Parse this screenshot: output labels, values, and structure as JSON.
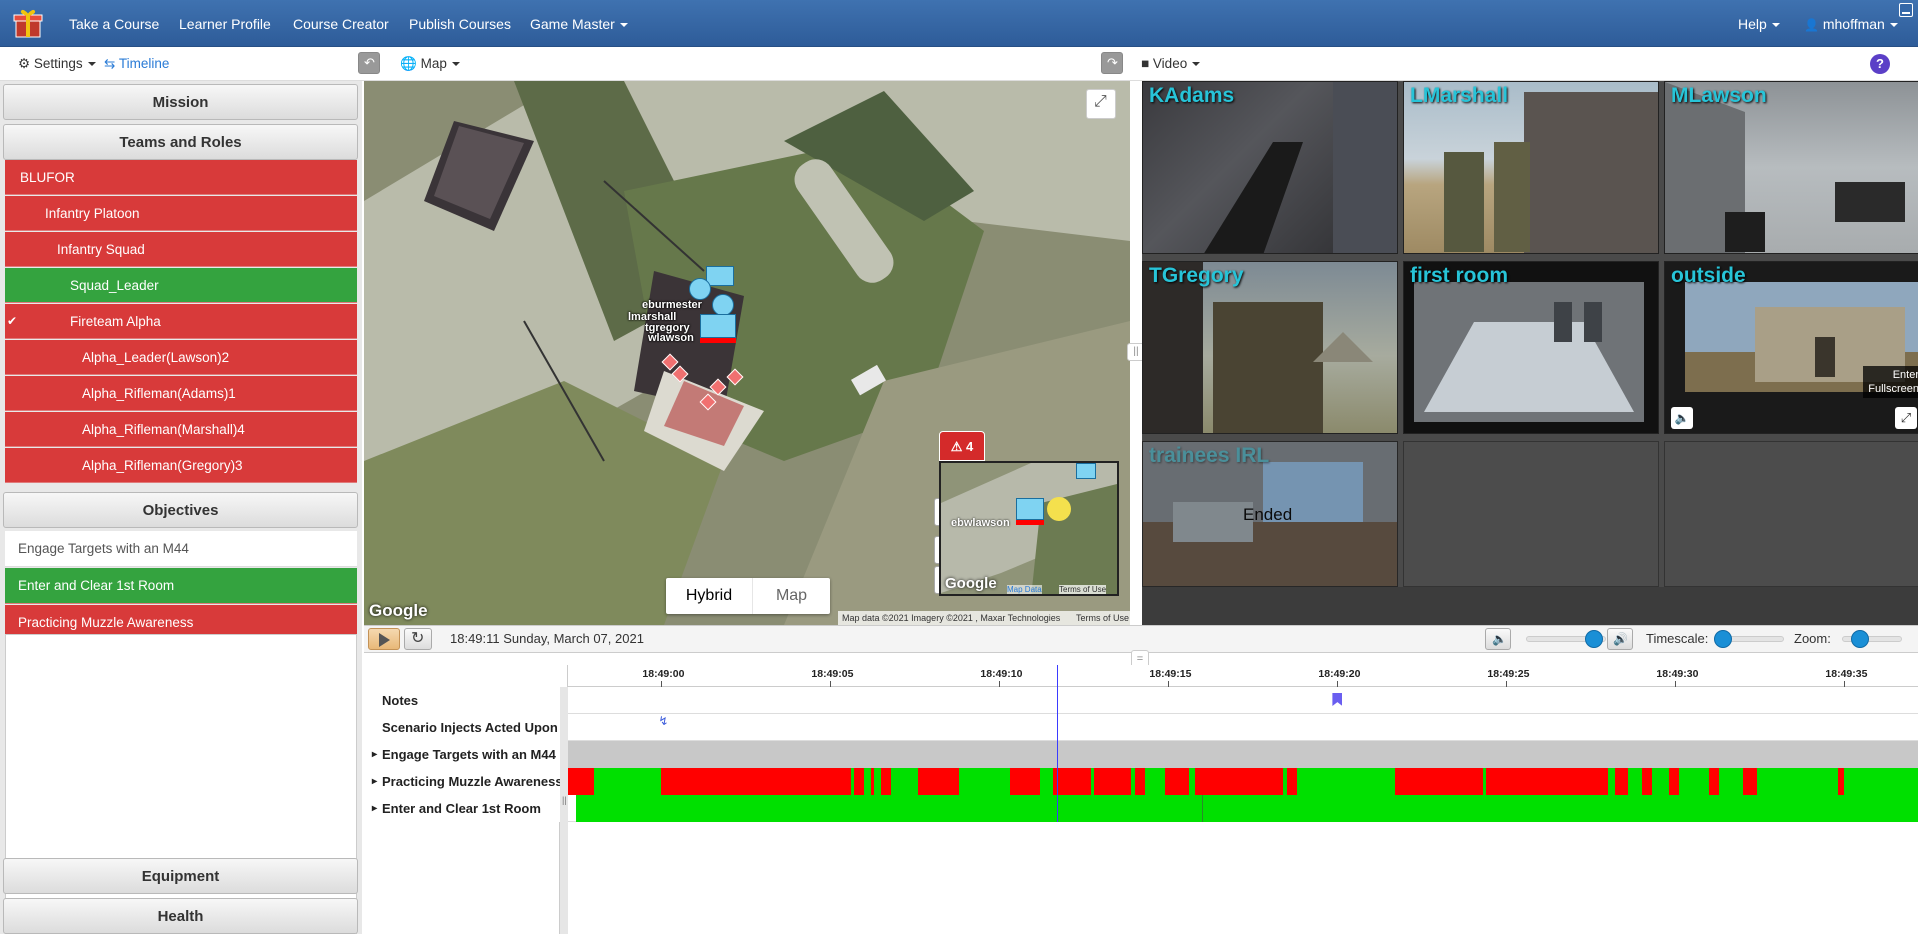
{
  "navbar": {
    "logo_icon": "gift-icon",
    "items": [
      "Take a Course",
      "Learner Profile",
      "Course Creator",
      "Publish Courses",
      "Game Master"
    ],
    "help": "Help",
    "user": "mhoffman",
    "bg": "#3568a8"
  },
  "toolbar": {
    "settings": "Settings",
    "timeline": "Timeline",
    "map": "Map",
    "video": "Video"
  },
  "sidebar": {
    "mission": "Mission",
    "teams_title": "Teams and Roles",
    "roles": [
      {
        "label": "BLUFOR",
        "status": "red",
        "indent": 0,
        "checked": false
      },
      {
        "label": "Infantry Platoon",
        "status": "red",
        "indent": 1,
        "checked": false
      },
      {
        "label": "Infantry Squad",
        "status": "red",
        "indent": 2,
        "checked": false
      },
      {
        "label": "Squad_Leader",
        "status": "green",
        "indent": 3,
        "checked": false
      },
      {
        "label": "Fireteam Alpha",
        "status": "red",
        "indent": 3,
        "checked": true
      },
      {
        "label": "Alpha_Leader(Lawson)2",
        "status": "red",
        "indent": 4,
        "checked": false
      },
      {
        "label": "Alpha_Rifleman(Adams)1",
        "status": "red",
        "indent": 4,
        "checked": false
      },
      {
        "label": "Alpha_Rifleman(Marshall)4",
        "status": "red",
        "indent": 4,
        "checked": false
      },
      {
        "label": "Alpha_Rifleman(Gregory)3",
        "status": "red",
        "indent": 4,
        "checked": false
      }
    ],
    "objectives_title": "Objectives",
    "objectives": [
      {
        "label": "Engage Targets with an M44",
        "status": "white"
      },
      {
        "label": "Enter and Clear 1st Room",
        "status": "green"
      },
      {
        "label": "Practicing Muzzle Awareness",
        "status": "red"
      }
    ],
    "equipment": "Equipment",
    "health": "Health"
  },
  "map": {
    "unit_labels": [
      "eburmester",
      "lmarshall",
      "tgregory",
      "wlawson"
    ],
    "google": "Google",
    "type_buttons": [
      "Hybrid",
      "Map"
    ],
    "attribution": "Map data ©2021 Imagery ©2021 , Maxar Technologies",
    "terms": "Terms of Use",
    "alert_count": "4",
    "minimap_label": "wlawson",
    "minimap_label_prefix": "eb",
    "minimap_google": "Google",
    "minimap_mapdata": "Map Data",
    "minimap_terms": "Terms of Use"
  },
  "video": {
    "cells": [
      {
        "label": "KAdams"
      },
      {
        "label": "LMarshall"
      },
      {
        "label": "MLawson"
      },
      {
        "label": "TGregory"
      },
      {
        "label": "first room"
      },
      {
        "label": "outside"
      },
      {
        "label": "trainees IRL"
      }
    ],
    "fullscreen_tooltip": "Enter Fullscreen",
    "ended": "Ended"
  },
  "playback": {
    "timestamp": "18:49:11 Sunday, March 07, 2021",
    "timescale": "Timescale:",
    "zoom": "Zoom:",
    "volume_level": 0.85,
    "timescale_level": 0.05,
    "zoom_level": 0.3
  },
  "timeline": {
    "ticks": [
      "18:49:00",
      "18:49:05",
      "18:49:10",
      "18:49:15",
      "18:49:20",
      "18:49:25",
      "18:49:30",
      "18:49:35"
    ],
    "rows": [
      {
        "label": "Notes",
        "expandable": false
      },
      {
        "label": "Scenario Injects Acted Upon",
        "expandable": false
      },
      {
        "label": "Engage Targets with an M44",
        "expandable": true
      },
      {
        "label": "Practicing Muzzle Awareness",
        "expandable": true
      },
      {
        "label": "Enter and Clear 1st Room",
        "expandable": true
      }
    ],
    "playhead_time": "18:49:11.7",
    "note_marker_time": "18:49:20",
    "inject_marker_time": "18:49:00",
    "muzzle_red_segments": [
      [
        "18:48:57",
        "18:48:58"
      ],
      [
        "18:49:00",
        "18:49:05.6"
      ],
      [
        "18:49:05.7",
        "18:49:06"
      ],
      [
        "18:49:06.2",
        "18:49:06.3"
      ],
      [
        "18:49:06.5",
        "18:49:06.8"
      ],
      [
        "18:49:07.6",
        "18:49:08.8"
      ],
      [
        "18:49:10.3",
        "18:49:11.2"
      ],
      [
        "18:49:11.6",
        "18:49:12.7"
      ],
      [
        "18:49:12.8",
        "18:49:13.9"
      ],
      [
        "18:49:14.0",
        "18:49:14.3"
      ],
      [
        "18:49:14.9",
        "18:49:15.6"
      ],
      [
        "18:49:15.8",
        "18:49:18.4"
      ],
      [
        "18:49:18.5",
        "18:49:18.8"
      ],
      [
        "18:49:21.7",
        "18:49:24.3"
      ],
      [
        "18:49:24.4",
        "18:49:28.0"
      ],
      [
        "18:49:28.2",
        "18:49:28.6"
      ],
      [
        "18:49:29.0",
        "18:49:29.3"
      ],
      [
        "18:49:29.8",
        "18:49:30.1"
      ],
      [
        "18:49:31.0",
        "18:49:31.3"
      ],
      [
        "18:49:32.0",
        "18:49:32.4"
      ],
      [
        "18:49:34.8",
        "18:49:35.0"
      ]
    ],
    "colors": {
      "red": "#ff0000",
      "green": "#00e000",
      "gray": "#c8c8c8"
    }
  }
}
